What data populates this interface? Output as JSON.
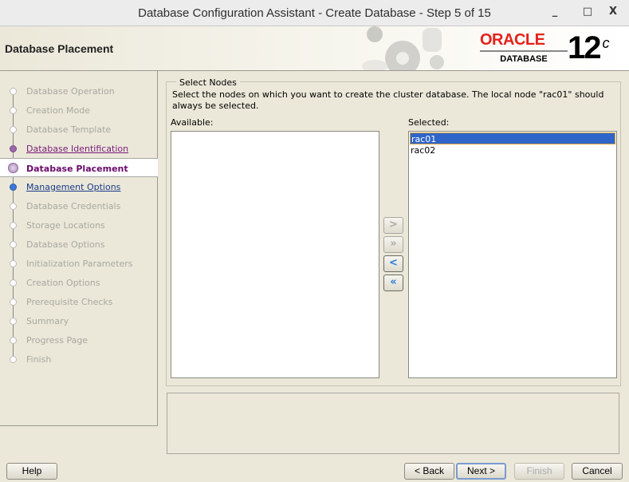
{
  "window": {
    "title": "Database Configuration Assistant - Create Database - Step 5 of 15",
    "minimize": "_",
    "maximize": "□",
    "close": "X"
  },
  "header": {
    "title": "Database Placement",
    "logo_oracle": "ORACLE",
    "logo_database": "DATABASE",
    "logo_version": "12",
    "logo_version_sup": "c"
  },
  "steps": [
    {
      "label": "Database Operation",
      "state": "disabled"
    },
    {
      "label": "Creation Mode",
      "state": "disabled"
    },
    {
      "label": "Database Template",
      "state": "disabled"
    },
    {
      "label": "Database Identification",
      "state": "visited"
    },
    {
      "label": "Database Placement",
      "state": "current"
    },
    {
      "label": "Management Options",
      "state": "link"
    },
    {
      "label": "Database Credentials",
      "state": "disabled"
    },
    {
      "label": "Storage Locations",
      "state": "disabled"
    },
    {
      "label": "Database Options",
      "state": "disabled"
    },
    {
      "label": "Initialization Parameters",
      "state": "disabled"
    },
    {
      "label": "Creation Options",
      "state": "disabled"
    },
    {
      "label": "Prerequisite Checks",
      "state": "disabled"
    },
    {
      "label": "Summary",
      "state": "disabled"
    },
    {
      "label": "Progress Page",
      "state": "disabled"
    },
    {
      "label": "Finish",
      "state": "disabled"
    }
  ],
  "main": {
    "group_title": "Select Nodes",
    "description": "Select the nodes on which you want to create the cluster database. The local node \"rac01\" should always be selected.",
    "available_label": "Available:",
    "selected_label": "Selected:",
    "available_items": [],
    "selected_items": [
      {
        "label": "rac01",
        "selected": true
      },
      {
        "label": "rac02",
        "selected": false
      }
    ],
    "move_buttons": {
      "add": ">",
      "add_all": "»",
      "remove": "<",
      "remove_all": "«"
    }
  },
  "footer": {
    "help": "Help",
    "back": "< Back",
    "next": "Next >",
    "finish": "Finish",
    "cancel": "Cancel"
  }
}
